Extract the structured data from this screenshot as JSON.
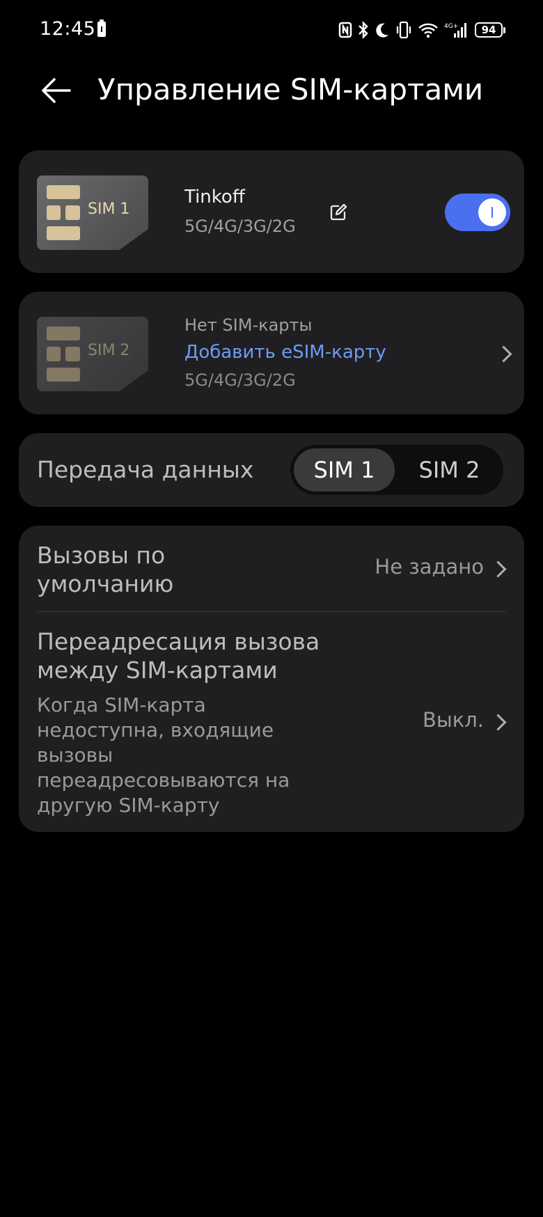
{
  "status_bar": {
    "time": "12:45",
    "battery_percent": "94",
    "icons": [
      "nfc-icon",
      "bluetooth-icon",
      "moon-icon",
      "vibrate-icon",
      "wifi-icon",
      "signal-4g-icon",
      "battery-icon"
    ],
    "network_label": "4G+"
  },
  "header": {
    "title": "Управление SIM-картами"
  },
  "sim1": {
    "badge": "SIM 1",
    "name": "Tinkoff",
    "networks": "5G/4G/3G/2G",
    "enabled": true
  },
  "sim2": {
    "badge": "SIM 2",
    "status": "Нет SIM-карты",
    "add_label": "Добавить eSIM-карту",
    "networks": "5G/4G/3G/2G"
  },
  "data_transfer": {
    "label": "Передача данных",
    "options": [
      "SIM 1",
      "SIM 2"
    ],
    "selected": "SIM 1"
  },
  "calls": {
    "default_label": "Вызовы по умолчанию",
    "default_value": "Не задано",
    "forward_label": "Переадресация вызова между SIM-картами",
    "forward_desc": "Когда SIM-карта недоступна, входящие вызовы переадресовываются на другую SIM-карту",
    "forward_value": "Выкл."
  },
  "colors": {
    "accent": "#4a70f0",
    "link": "#6f9bf5",
    "card_bg": "#1f1f21",
    "background": "#000000"
  }
}
